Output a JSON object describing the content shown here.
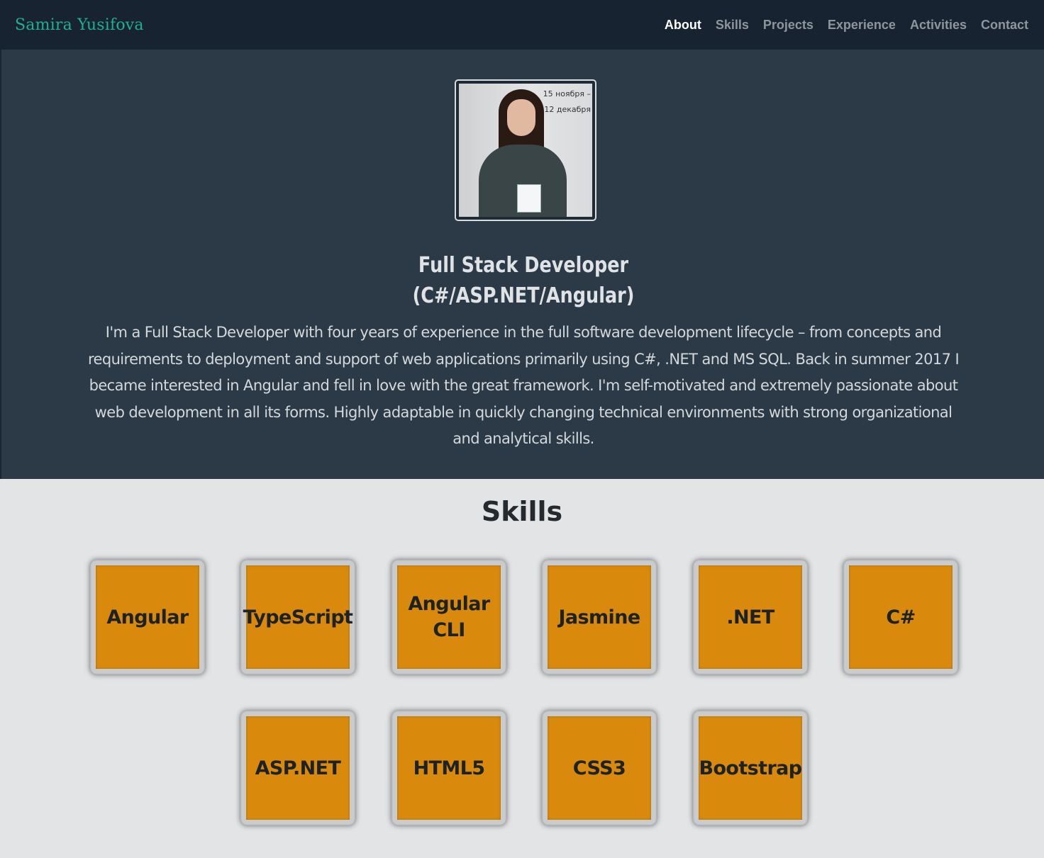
{
  "nav": {
    "brand": "Samira Yusifova",
    "items": [
      {
        "label": "About",
        "active": true
      },
      {
        "label": "Skills",
        "active": false
      },
      {
        "label": "Projects",
        "active": false
      },
      {
        "label": "Experience",
        "active": false
      },
      {
        "label": "Activities",
        "active": false
      },
      {
        "label": "Contact",
        "active": false
      }
    ]
  },
  "about": {
    "title_line1": "Full Stack Developer",
    "title_line2": "(C#/ASP.NET/Angular)",
    "intro": "I'm a Full Stack Developer with four years of experience in the full software development lifecycle – from concepts and requirements to deployment and support of web applications primarily using C#, .NET and MS SQL. Back in summer 2017 I became interested in Angular and fell in love with the great framework. I'm self-motivated and extremely passionate about web development in all its forms. Highly adaptable in quickly changing technical environments with strong organizational and analytical skills.",
    "photo_sign": [
      "15 ноября –",
      "12 декабря"
    ]
  },
  "skills": {
    "heading": "Skills",
    "items": [
      "Angular",
      "TypeScript",
      "Angular CLI",
      "Jasmine",
      ".NET",
      "C#",
      "ASP.NET",
      "HTML5",
      "CSS3",
      "Bootstrap"
    ]
  },
  "colors": {
    "navbar": "#172330",
    "brand": "#1fb08e",
    "about_bg": "#2c3946",
    "skills_bg": "#e3e4e6",
    "tile": "#d98a0d"
  }
}
